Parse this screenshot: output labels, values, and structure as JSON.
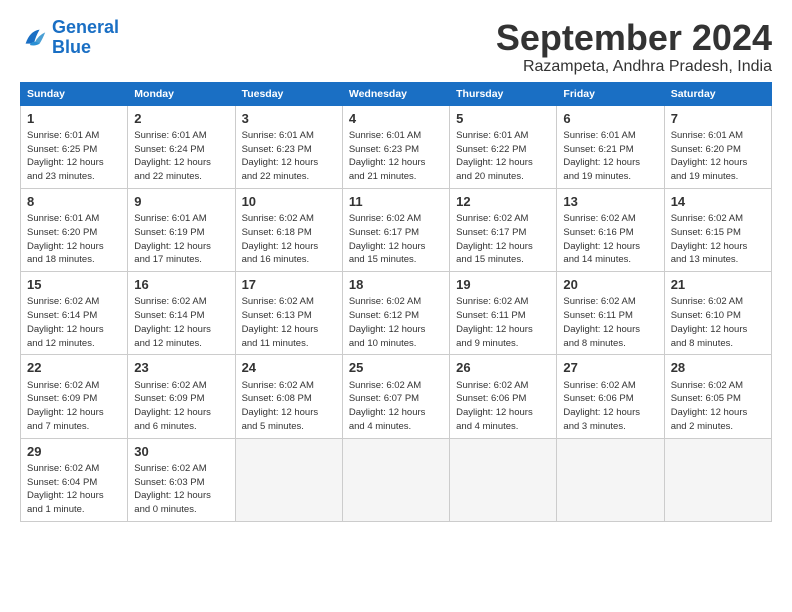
{
  "logo": {
    "line1": "General",
    "line2": "Blue"
  },
  "title": "September 2024",
  "subtitle": "Razampeta, Andhra Pradesh, India",
  "headers": [
    "Sunday",
    "Monday",
    "Tuesday",
    "Wednesday",
    "Thursday",
    "Friday",
    "Saturday"
  ],
  "weeks": [
    [
      {
        "day": "1",
        "lines": [
          "Sunrise: 6:01 AM",
          "Sunset: 6:25 PM",
          "Daylight: 12 hours",
          "and 23 minutes."
        ]
      },
      {
        "day": "2",
        "lines": [
          "Sunrise: 6:01 AM",
          "Sunset: 6:24 PM",
          "Daylight: 12 hours",
          "and 22 minutes."
        ]
      },
      {
        "day": "3",
        "lines": [
          "Sunrise: 6:01 AM",
          "Sunset: 6:23 PM",
          "Daylight: 12 hours",
          "and 22 minutes."
        ]
      },
      {
        "day": "4",
        "lines": [
          "Sunrise: 6:01 AM",
          "Sunset: 6:23 PM",
          "Daylight: 12 hours",
          "and 21 minutes."
        ]
      },
      {
        "day": "5",
        "lines": [
          "Sunrise: 6:01 AM",
          "Sunset: 6:22 PM",
          "Daylight: 12 hours",
          "and 20 minutes."
        ]
      },
      {
        "day": "6",
        "lines": [
          "Sunrise: 6:01 AM",
          "Sunset: 6:21 PM",
          "Daylight: 12 hours",
          "and 19 minutes."
        ]
      },
      {
        "day": "7",
        "lines": [
          "Sunrise: 6:01 AM",
          "Sunset: 6:20 PM",
          "Daylight: 12 hours",
          "and 19 minutes."
        ]
      }
    ],
    [
      {
        "day": "8",
        "lines": [
          "Sunrise: 6:01 AM",
          "Sunset: 6:20 PM",
          "Daylight: 12 hours",
          "and 18 minutes."
        ]
      },
      {
        "day": "9",
        "lines": [
          "Sunrise: 6:01 AM",
          "Sunset: 6:19 PM",
          "Daylight: 12 hours",
          "and 17 minutes."
        ]
      },
      {
        "day": "10",
        "lines": [
          "Sunrise: 6:02 AM",
          "Sunset: 6:18 PM",
          "Daylight: 12 hours",
          "and 16 minutes."
        ]
      },
      {
        "day": "11",
        "lines": [
          "Sunrise: 6:02 AM",
          "Sunset: 6:17 PM",
          "Daylight: 12 hours",
          "and 15 minutes."
        ]
      },
      {
        "day": "12",
        "lines": [
          "Sunrise: 6:02 AM",
          "Sunset: 6:17 PM",
          "Daylight: 12 hours",
          "and 15 minutes."
        ]
      },
      {
        "day": "13",
        "lines": [
          "Sunrise: 6:02 AM",
          "Sunset: 6:16 PM",
          "Daylight: 12 hours",
          "and 14 minutes."
        ]
      },
      {
        "day": "14",
        "lines": [
          "Sunrise: 6:02 AM",
          "Sunset: 6:15 PM",
          "Daylight: 12 hours",
          "and 13 minutes."
        ]
      }
    ],
    [
      {
        "day": "15",
        "lines": [
          "Sunrise: 6:02 AM",
          "Sunset: 6:14 PM",
          "Daylight: 12 hours",
          "and 12 minutes."
        ]
      },
      {
        "day": "16",
        "lines": [
          "Sunrise: 6:02 AM",
          "Sunset: 6:14 PM",
          "Daylight: 12 hours",
          "and 12 minutes."
        ]
      },
      {
        "day": "17",
        "lines": [
          "Sunrise: 6:02 AM",
          "Sunset: 6:13 PM",
          "Daylight: 12 hours",
          "and 11 minutes."
        ]
      },
      {
        "day": "18",
        "lines": [
          "Sunrise: 6:02 AM",
          "Sunset: 6:12 PM",
          "Daylight: 12 hours",
          "and 10 minutes."
        ]
      },
      {
        "day": "19",
        "lines": [
          "Sunrise: 6:02 AM",
          "Sunset: 6:11 PM",
          "Daylight: 12 hours",
          "and 9 minutes."
        ]
      },
      {
        "day": "20",
        "lines": [
          "Sunrise: 6:02 AM",
          "Sunset: 6:11 PM",
          "Daylight: 12 hours",
          "and 8 minutes."
        ]
      },
      {
        "day": "21",
        "lines": [
          "Sunrise: 6:02 AM",
          "Sunset: 6:10 PM",
          "Daylight: 12 hours",
          "and 8 minutes."
        ]
      }
    ],
    [
      {
        "day": "22",
        "lines": [
          "Sunrise: 6:02 AM",
          "Sunset: 6:09 PM",
          "Daylight: 12 hours",
          "and 7 minutes."
        ]
      },
      {
        "day": "23",
        "lines": [
          "Sunrise: 6:02 AM",
          "Sunset: 6:09 PM",
          "Daylight: 12 hours",
          "and 6 minutes."
        ]
      },
      {
        "day": "24",
        "lines": [
          "Sunrise: 6:02 AM",
          "Sunset: 6:08 PM",
          "Daylight: 12 hours",
          "and 5 minutes."
        ]
      },
      {
        "day": "25",
        "lines": [
          "Sunrise: 6:02 AM",
          "Sunset: 6:07 PM",
          "Daylight: 12 hours",
          "and 4 minutes."
        ]
      },
      {
        "day": "26",
        "lines": [
          "Sunrise: 6:02 AM",
          "Sunset: 6:06 PM",
          "Daylight: 12 hours",
          "and 4 minutes."
        ]
      },
      {
        "day": "27",
        "lines": [
          "Sunrise: 6:02 AM",
          "Sunset: 6:06 PM",
          "Daylight: 12 hours",
          "and 3 minutes."
        ]
      },
      {
        "day": "28",
        "lines": [
          "Sunrise: 6:02 AM",
          "Sunset: 6:05 PM",
          "Daylight: 12 hours",
          "and 2 minutes."
        ]
      }
    ],
    [
      {
        "day": "29",
        "lines": [
          "Sunrise: 6:02 AM",
          "Sunset: 6:04 PM",
          "Daylight: 12 hours",
          "and 1 minute."
        ]
      },
      {
        "day": "30",
        "lines": [
          "Sunrise: 6:02 AM",
          "Sunset: 6:03 PM",
          "Daylight: 12 hours",
          "and 0 minutes."
        ]
      },
      null,
      null,
      null,
      null,
      null
    ]
  ]
}
